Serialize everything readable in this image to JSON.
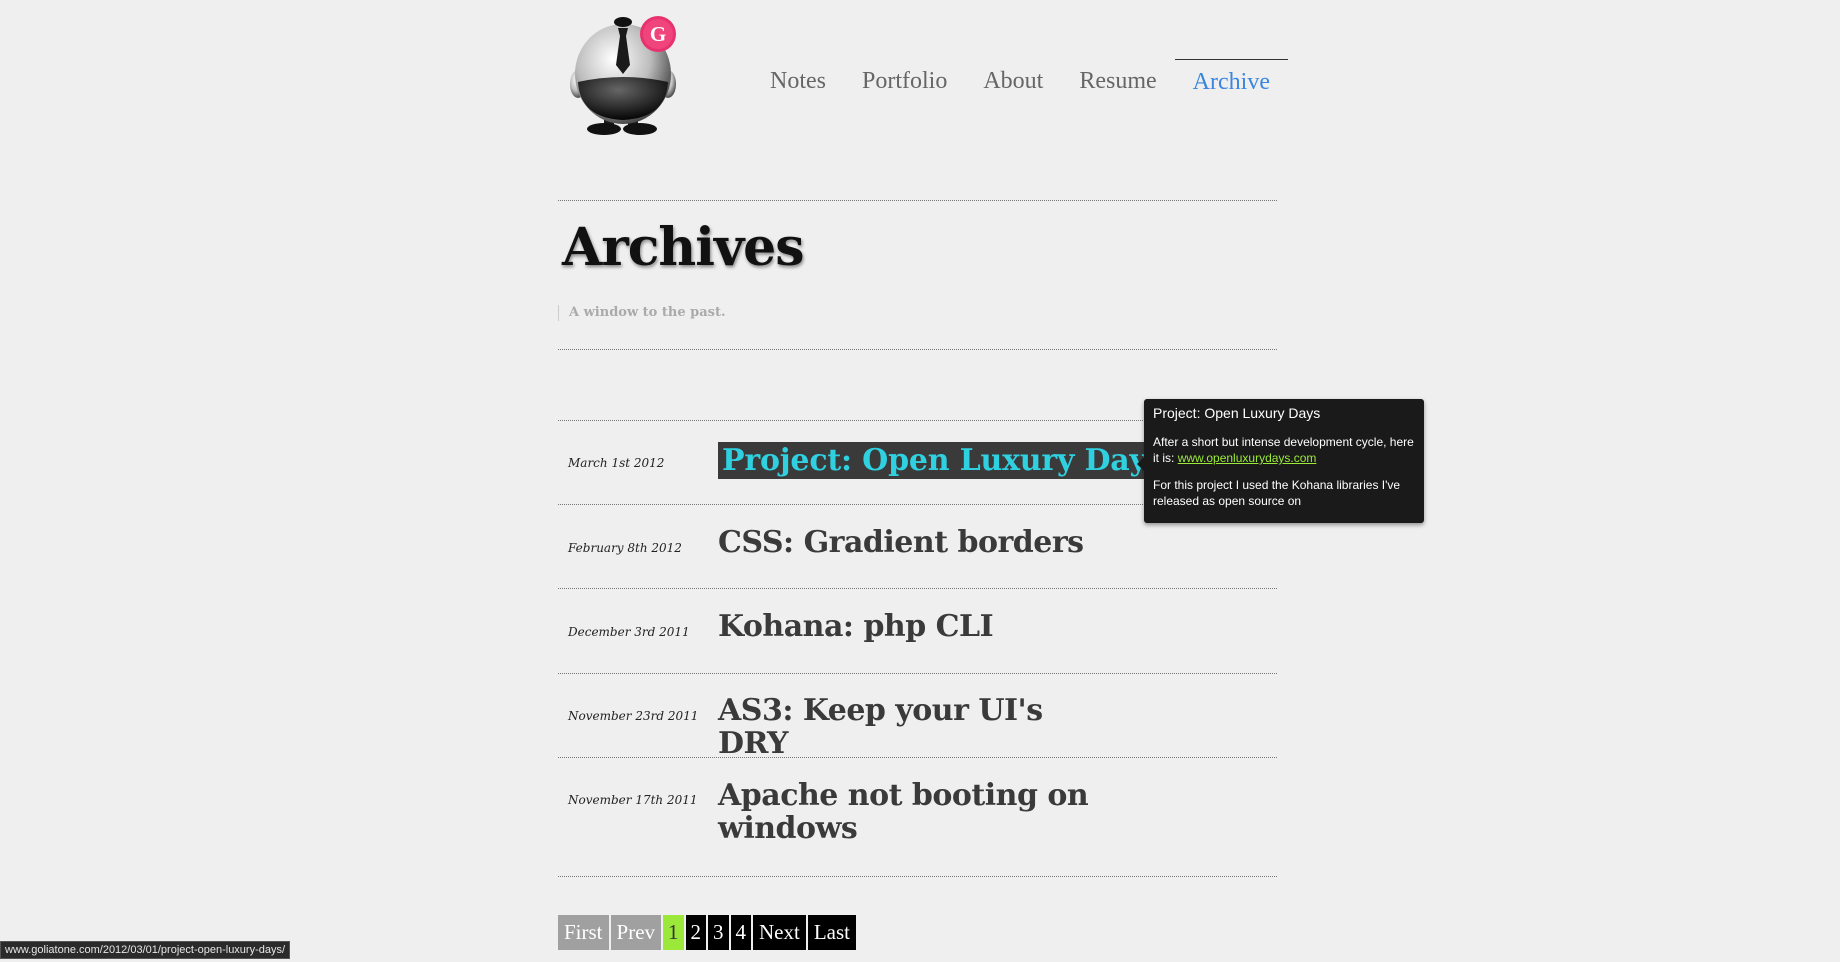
{
  "logo": {
    "badge_letter": "G"
  },
  "nav": {
    "items": [
      {
        "label": "Notes"
      },
      {
        "label": "Portfolio"
      },
      {
        "label": "About"
      },
      {
        "label": "Resume"
      },
      {
        "label": "Archive"
      }
    ],
    "active": "Archive"
  },
  "header": {
    "title": "Archives",
    "subtitle": "A window to the past."
  },
  "archive": {
    "entries": [
      {
        "date": "March 1st 2012",
        "title": "Project: Open Luxury Days",
        "highlighted": true
      },
      {
        "date": "February 8th 2012",
        "title": "CSS: Gradient borders"
      },
      {
        "date": "December 3rd 2011",
        "title": "Kohana: php CLI"
      },
      {
        "date": "November 23rd 2011",
        "title": "AS3: Keep your UI's DRY"
      },
      {
        "date": "November 17th 2011",
        "title": "Apache not booting on windows"
      }
    ]
  },
  "tooltip": {
    "title": "Project: Open Luxury Days",
    "text1": "After a short but intense development cycle, here it is:",
    "link": "www.openluxurydays.com",
    "text2": "For this project I used the Kohana libraries I've released as open source on"
  },
  "pagination": {
    "first": "First",
    "prev": "Prev",
    "pages": [
      "1",
      "2",
      "3",
      "4"
    ],
    "current": "1",
    "next": "Next",
    "last": "Last"
  },
  "statusbar": {
    "url": "www.goliatone.com/2012/03/01/project-open-luxury-days/"
  },
  "colors": {
    "background": "#efefef",
    "nav_active": "#3a86e0",
    "highlight_text": "#2fd0e0",
    "highlight_bg": "#3a3a3a",
    "pagination_current": "#9be83b",
    "tooltip_link": "#9bea3a",
    "badge": "#e8326f"
  }
}
